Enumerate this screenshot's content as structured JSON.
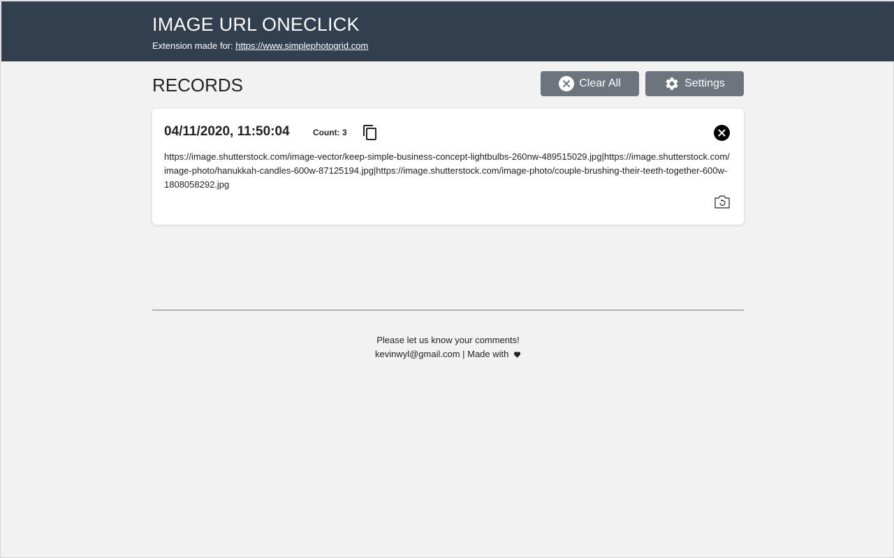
{
  "header": {
    "title": "IMAGE URL ONECLICK",
    "subtitle_prefix": "Extension made for: ",
    "subtitle_link": "https://www.simplephotogrid.com"
  },
  "records_section": {
    "title": "RECORDS",
    "clear_all_label": "Clear All",
    "settings_label": "Settings"
  },
  "records": [
    {
      "datetime": "04/11/2020, 11:50:04",
      "count_label": "Count: 3",
      "urls": "https://image.shutterstock.com/image-vector/keep-simple-business-concept-lightbulbs-260nw-489515029.jpg|https://image.shutterstock.com/image-photo/hanukkah-candles-600w-87125194.jpg|https://image.shutterstock.com/image-photo/couple-brushing-their-teeth-together-600w-1808058292.jpg"
    }
  ],
  "footer": {
    "line1": "Please let us know your comments!",
    "line2": "kevinwyl@gmail.com | Made with"
  },
  "icons": {
    "clear": "close-circle-icon",
    "settings": "gear-icon",
    "copy": "copy-icon",
    "delete": "close-circle-filled-icon",
    "restore": "restore-image-icon",
    "heart": "heart-icon"
  },
  "colors": {
    "header_bg": "#323f4f",
    "button_bg": "#6c757d",
    "page_bg": "#f2f2f2"
  }
}
